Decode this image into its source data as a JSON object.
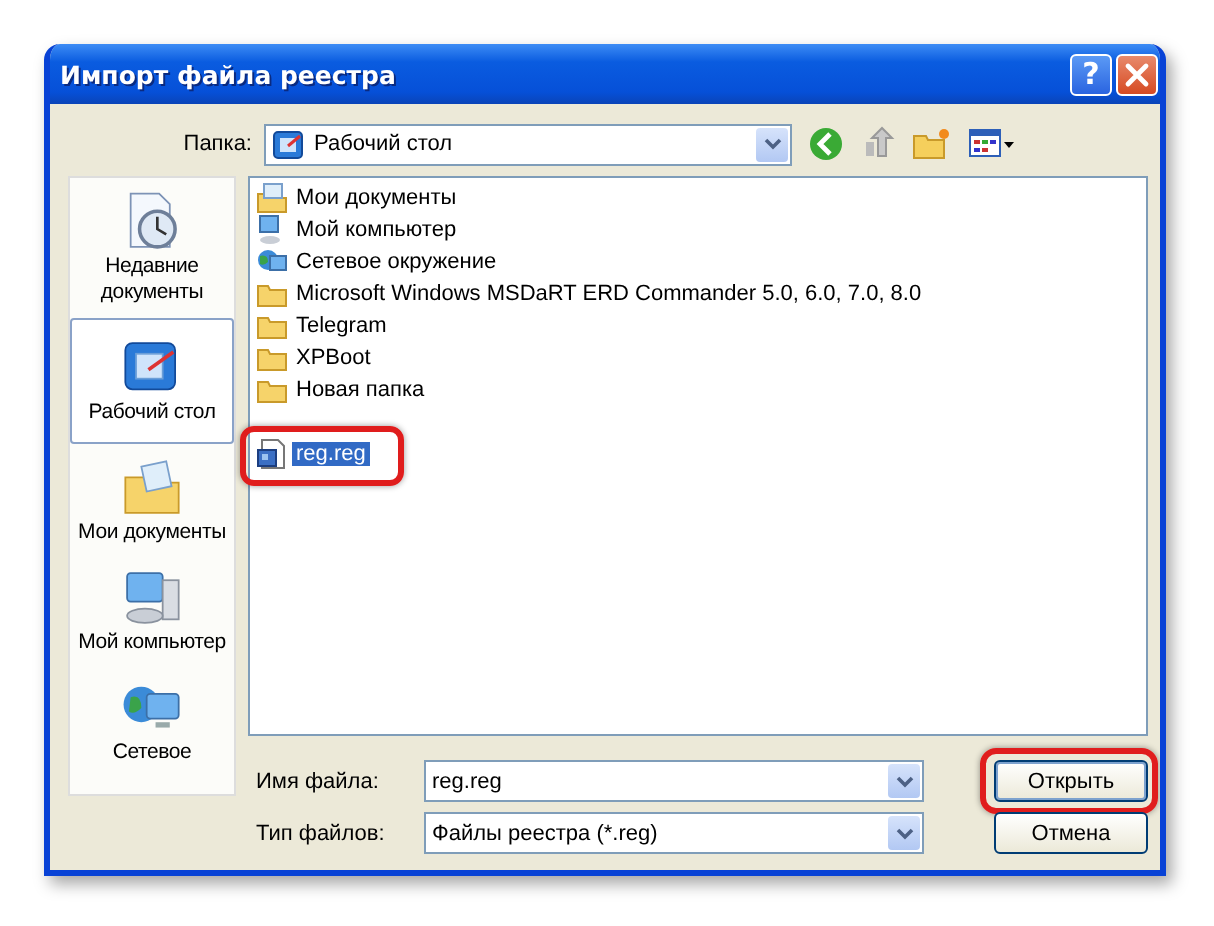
{
  "window": {
    "title": "Импорт файла реестра",
    "help_button": "?"
  },
  "folder": {
    "label": "Папка:",
    "value": "Рабочий стол"
  },
  "places": [
    {
      "label": "Недавние документы",
      "kind": "recent",
      "selected": false
    },
    {
      "label": "Рабочий стол",
      "kind": "desktop",
      "selected": true
    },
    {
      "label": "Мои документы",
      "kind": "documents",
      "selected": false
    },
    {
      "label": "Мой компьютер",
      "kind": "computer",
      "selected": false
    },
    {
      "label": "Сетевое",
      "kind": "network",
      "selected": false
    }
  ],
  "files": [
    {
      "name": "Мои документы",
      "kind": "documents",
      "selected": false,
      "highlighted": false
    },
    {
      "name": "Мой компьютер",
      "kind": "computer",
      "selected": false,
      "highlighted": false
    },
    {
      "name": "Сетевое окружение",
      "kind": "network",
      "selected": false,
      "highlighted": false
    },
    {
      "name": "Microsoft Windows MSDaRT ERD Commander 5.0, 6.0, 7.0, 8.0",
      "kind": "folder",
      "selected": false,
      "highlighted": false
    },
    {
      "name": "Telegram",
      "kind": "folder",
      "selected": false,
      "highlighted": false
    },
    {
      "name": "XPBoot",
      "kind": "folder",
      "selected": false,
      "highlighted": false
    },
    {
      "name": "Новая папка",
      "kind": "folder",
      "selected": false,
      "highlighted": false
    },
    {
      "name": "reg.reg",
      "kind": "reg",
      "selected": true,
      "highlighted": true
    }
  ],
  "file_name": {
    "label": "Имя файла:",
    "value": "reg.reg"
  },
  "file_type": {
    "label": "Тип файлов:",
    "value": "Файлы реестра (*.reg)"
  },
  "buttons": [
    {
      "label": "Открыть",
      "highlighted": true
    },
    {
      "label": "Отмена",
      "highlighted": false
    }
  ]
}
